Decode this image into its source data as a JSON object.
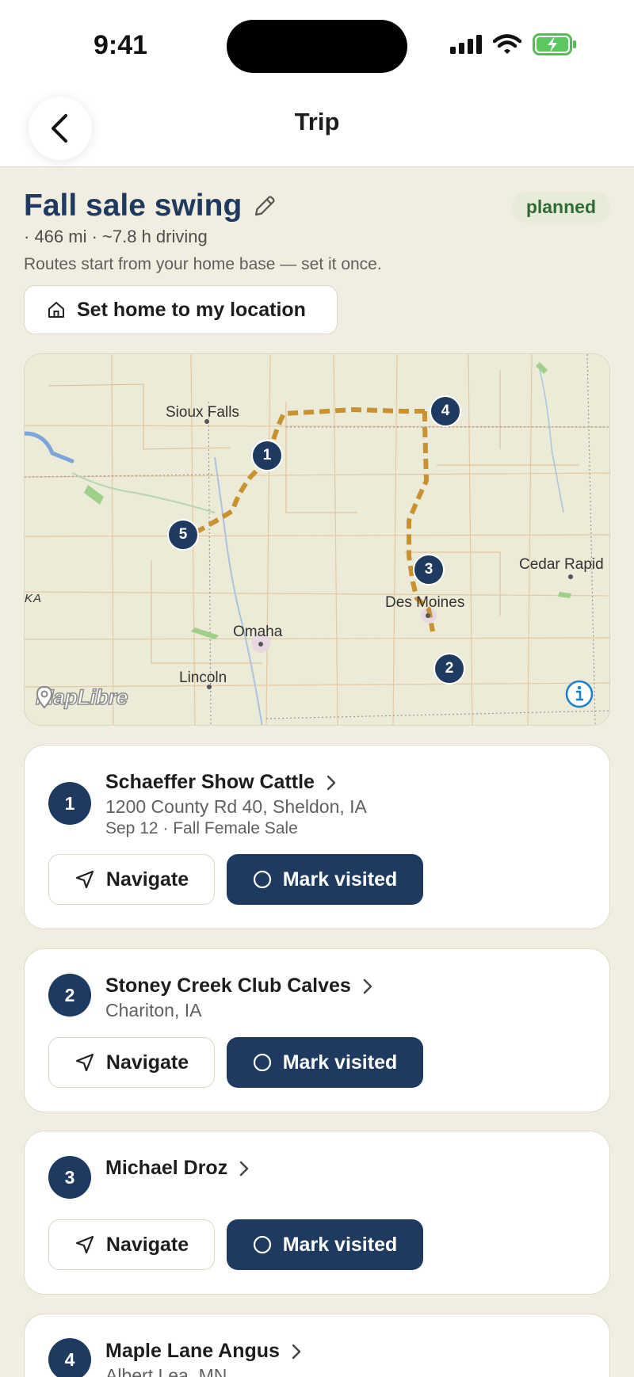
{
  "status_bar": {
    "time": "9:41"
  },
  "nav": {
    "title": "Trip"
  },
  "trip": {
    "title": "Fall sale swing",
    "status": "planned",
    "meta": "· 466 mi · ~7.8 h driving",
    "hint": "Routes start from your home base — set it once.",
    "home_button_label": "Set home to my location"
  },
  "map": {
    "attribution": "MapLibre",
    "cities": [
      "Sioux Falls",
      "Omaha",
      "Lincoln",
      "Des Moines",
      "Cedar Rapid",
      "KA"
    ],
    "markers": [
      "1",
      "2",
      "3",
      "4",
      "5"
    ],
    "route_color": "#c9912f"
  },
  "stops": [
    {
      "number": "1",
      "name": "Schaeffer Show Cattle",
      "address": "1200 County Rd 40, Sheldon, IA",
      "date": "Sep 12 · Fall Female Sale",
      "navigate_label": "Navigate",
      "visit_label": "Mark visited"
    },
    {
      "number": "2",
      "name": "Stoney Creek Club Calves",
      "address": "Chariton, IA",
      "navigate_label": "Navigate",
      "visit_label": "Mark visited"
    },
    {
      "number": "3",
      "name": "Michael Droz",
      "navigate_label": "Navigate",
      "visit_label": "Mark visited"
    },
    {
      "number": "4",
      "name": "Maple Lane Angus",
      "address": "Albert Lea, MN"
    }
  ],
  "colors": {
    "accent": "#1f3a60",
    "background": "#f1ede0",
    "badge_text": "#2e6b37",
    "badge_bg": "#e7ecd8"
  }
}
